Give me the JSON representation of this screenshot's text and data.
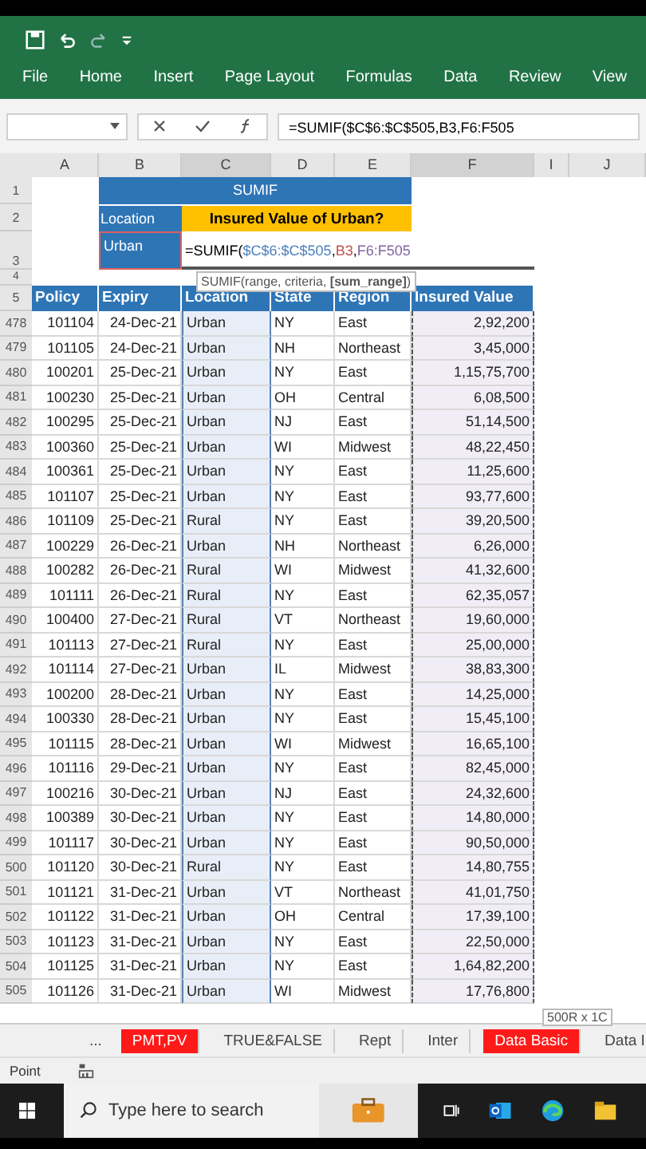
{
  "ribbon_tabs": [
    {
      "label": "File"
    },
    {
      "label": "Home"
    },
    {
      "label": "Insert"
    },
    {
      "label": "Page Layout"
    },
    {
      "label": "Formulas"
    },
    {
      "label": "Data"
    },
    {
      "label": "Review"
    },
    {
      "label": "View"
    }
  ],
  "formula_bar": {
    "formula": "=SUMIF($C$6:$C$505,B3,F6:F505"
  },
  "column_headers": [
    "A",
    "B",
    "C",
    "D",
    "E",
    "F",
    "I",
    "J"
  ],
  "header_rows": [
    "1",
    "2",
    "3",
    "4",
    "5"
  ],
  "title": "SUMIF",
  "criteria_label": "Location",
  "question": "Insured Value of Urban?",
  "criteria_value": "Urban",
  "editing_formula": [
    {
      "text": "=SUMIF("
    },
    {
      "text": "$C$6:$C$505",
      "color": "#4a7fc0"
    },
    {
      "separator": ",",
      "text": "B3",
      "color": "#c0504d"
    },
    {
      "separator": ",",
      "text": "F6:F505",
      "color": "#8064a2"
    }
  ],
  "tooltip": "SUMIF(range, criteria, **[sum_range]**)",
  "table": {
    "columns": [
      "Policy",
      "Expiry",
      "Location",
      "State",
      "Region",
      "Insured Value"
    ],
    "rows": [
      {
        "row": "478",
        "cells": [
          "101104",
          "24-Dec-21",
          "Urban",
          "NY",
          "East",
          "2,92,200"
        ]
      },
      {
        "row": "479",
        "cells": [
          "101105",
          "24-Dec-21",
          "Urban",
          "NH",
          "Northeast",
          "3,45,000"
        ]
      },
      {
        "row": "480",
        "cells": [
          "100201",
          "25-Dec-21",
          "Urban",
          "NY",
          "East",
          "1,15,75,700"
        ]
      },
      {
        "row": "481",
        "cells": [
          "100230",
          "25-Dec-21",
          "Urban",
          "OH",
          "Central",
          "6,08,500"
        ]
      },
      {
        "row": "482",
        "cells": [
          "100295",
          "25-Dec-21",
          "Urban",
          "NJ",
          "East",
          "51,14,500"
        ]
      },
      {
        "row": "483",
        "cells": [
          "100360",
          "25-Dec-21",
          "Urban",
          "WI",
          "Midwest",
          "48,22,450"
        ]
      },
      {
        "row": "484",
        "cells": [
          "100361",
          "25-Dec-21",
          "Urban",
          "NY",
          "East",
          "11,25,600"
        ]
      },
      {
        "row": "485",
        "cells": [
          "101107",
          "25-Dec-21",
          "Urban",
          "NY",
          "East",
          "93,77,600"
        ]
      },
      {
        "row": "486",
        "cells": [
          "101109",
          "25-Dec-21",
          "Rural",
          "NY",
          "East",
          "39,20,500"
        ]
      },
      {
        "row": "487",
        "cells": [
          "100229",
          "26-Dec-21",
          "Urban",
          "NH",
          "Northeast",
          "6,26,000"
        ]
      },
      {
        "row": "488",
        "cells": [
          "100282",
          "26-Dec-21",
          "Rural",
          "WI",
          "Midwest",
          "41,32,600"
        ]
      },
      {
        "row": "489",
        "cells": [
          "101111",
          "26-Dec-21",
          "Rural",
          "NY",
          "East",
          "62,35,057"
        ]
      },
      {
        "row": "490",
        "cells": [
          "100400",
          "27-Dec-21",
          "Rural",
          "VT",
          "Northeast",
          "19,60,000"
        ]
      },
      {
        "row": "491",
        "cells": [
          "101113",
          "27-Dec-21",
          "Rural",
          "NY",
          "East",
          "25,00,000"
        ]
      },
      {
        "row": "492",
        "cells": [
          "101114",
          "27-Dec-21",
          "Urban",
          "IL",
          "Midwest",
          "38,83,300"
        ]
      },
      {
        "row": "493",
        "cells": [
          "100200",
          "28-Dec-21",
          "Urban",
          "NY",
          "East",
          "14,25,000"
        ]
      },
      {
        "row": "494",
        "cells": [
          "100330",
          "28-Dec-21",
          "Urban",
          "NY",
          "East",
          "15,45,100"
        ]
      },
      {
        "row": "495",
        "cells": [
          "101115",
          "28-Dec-21",
          "Urban",
          "WI",
          "Midwest",
          "16,65,100"
        ]
      },
      {
        "row": "496",
        "cells": [
          "101116",
          "29-Dec-21",
          "Urban",
          "NY",
          "East",
          "82,45,000"
        ]
      },
      {
        "row": "497",
        "cells": [
          "100216",
          "30-Dec-21",
          "Urban",
          "NJ",
          "East",
          "24,32,600"
        ]
      },
      {
        "row": "498",
        "cells": [
          "100389",
          "30-Dec-21",
          "Urban",
          "NY",
          "East",
          "14,80,000"
        ]
      },
      {
        "row": "499",
        "cells": [
          "101117",
          "30-Dec-21",
          "Urban",
          "NY",
          "East",
          "90,50,000"
        ]
      },
      {
        "row": "500",
        "cells": [
          "101120",
          "30-Dec-21",
          "Rural",
          "NY",
          "East",
          "14,80,755"
        ]
      },
      {
        "row": "501",
        "cells": [
          "101121",
          "31-Dec-21",
          "Urban",
          "VT",
          "Northeast",
          "41,01,750"
        ]
      },
      {
        "row": "502",
        "cells": [
          "101122",
          "31-Dec-21",
          "Urban",
          "OH",
          "Central",
          "17,39,100"
        ]
      },
      {
        "row": "503",
        "cells": [
          "101123",
          "31-Dec-21",
          "Urban",
          "NY",
          "East",
          "22,50,000"
        ]
      },
      {
        "row": "504",
        "cells": [
          "101125",
          "31-Dec-21",
          "Urban",
          "NY",
          "East",
          "1,64,82,200"
        ]
      },
      {
        "row": "505",
        "cells": [
          "101126",
          "31-Dec-21",
          "Urban",
          "WI",
          "Midwest",
          "17,76,800"
        ]
      }
    ]
  },
  "selection_size": "500R x 1C",
  "sheet_nav_more": "...",
  "sheet_tabs": [
    {
      "label": "PMT,PV",
      "color": "#ff1a1a"
    },
    {
      "label": "TRUE&FALSE"
    },
    {
      "label": "Rept"
    },
    {
      "label": "Inter"
    },
    {
      "label": "Data Basic",
      "color": "#ff1a1a"
    },
    {
      "label": "Data I"
    }
  ],
  "status_bar": {
    "mode": "Point"
  },
  "taskbar": {
    "search_placeholder": "Type here to search"
  }
}
